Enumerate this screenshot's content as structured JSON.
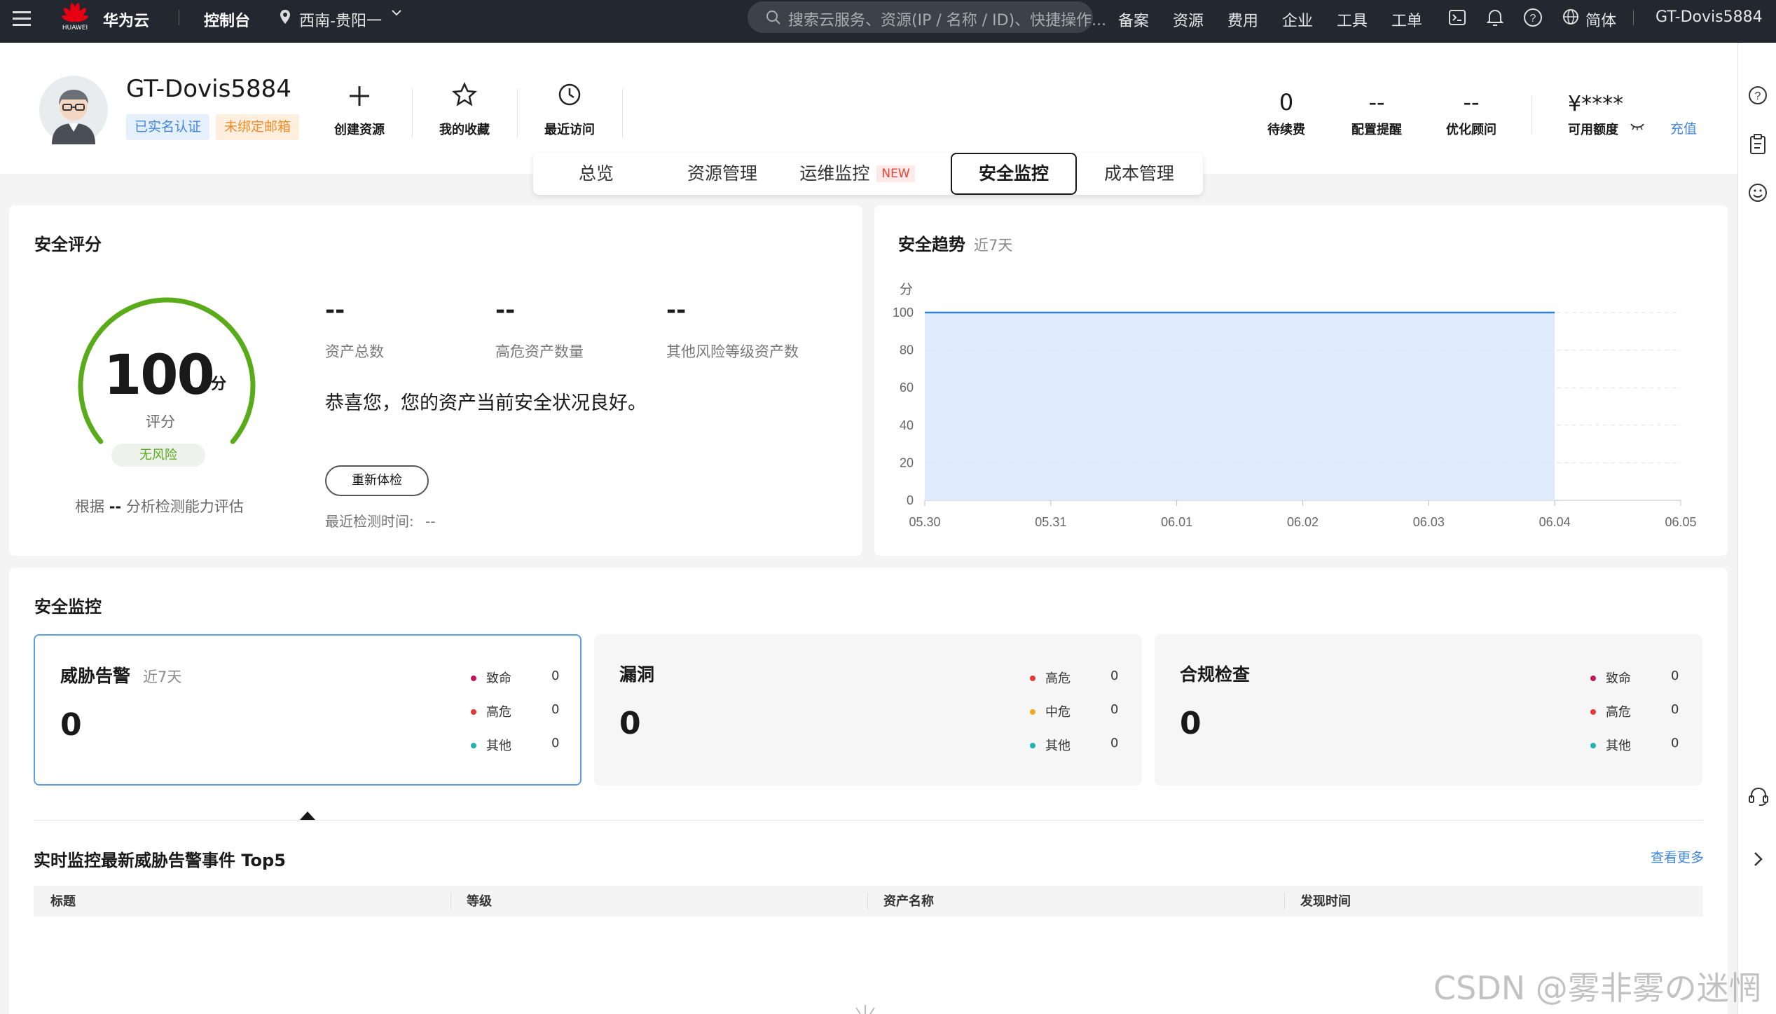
{
  "topbar": {
    "brand_logo_text": "HUAWEI",
    "brand": "华为云",
    "console": "控制台",
    "region": "西南-贵阳一",
    "search_placeholder": "搜索云服务、资源(IP / 名称 / ID)、快捷操作...",
    "nav": [
      "备案",
      "资源",
      "费用",
      "企业",
      "工具",
      "工单"
    ],
    "language": "简体",
    "user": "GT-Dovis5884"
  },
  "profile": {
    "username": "GT-Dovis5884",
    "badge_verified": "已实名认证",
    "badge_email": "未绑定邮箱",
    "quick_actions": [
      {
        "label": "创建资源",
        "icon": "plus-icon"
      },
      {
        "label": "我的收藏",
        "icon": "star-icon"
      },
      {
        "label": "最近访问",
        "icon": "clock-icon"
      }
    ],
    "stats": [
      {
        "value": "0",
        "label": "待续费"
      },
      {
        "value": "--",
        "label": "配置提醒"
      },
      {
        "value": "--",
        "label": "优化顾问"
      }
    ],
    "credit_value": "¥****",
    "credit_label": "可用额度",
    "recharge": "充值"
  },
  "tabs": [
    {
      "label": "总览"
    },
    {
      "label": "资源管理"
    },
    {
      "label": "运维监控",
      "tag": "NEW"
    },
    {
      "label": "安全监控",
      "active": true
    },
    {
      "label": "成本管理"
    }
  ],
  "score_card": {
    "title": "安全评分",
    "score": "100",
    "score_unit": "分",
    "score_label": "评分",
    "risk_badge": "无风险",
    "basis_prefix": "根据",
    "basis_value": "--",
    "basis_suffix": "分析检测能力评估",
    "score_fraction": 1.0,
    "metrics": [
      {
        "value": "--",
        "label": "资产总数"
      },
      {
        "value": "--",
        "label": "高危资产数量"
      },
      {
        "value": "--",
        "label": "其他风险等级资产数"
      }
    ],
    "message": "恭喜您，您的资产当前安全状况良好。",
    "recheck_button": "重新体检",
    "last_check_label": "最近检测时间:",
    "last_check_value": "--"
  },
  "trend_card": {
    "title": "安全趋势",
    "subtitle": "近7天"
  },
  "chart_data": {
    "type": "area",
    "title": "安全趋势",
    "ylabel": "分",
    "x": [
      "05.30",
      "05.31",
      "06.01",
      "06.02",
      "06.03",
      "06.04",
      "06.05"
    ],
    "values": [
      100,
      100,
      100,
      100,
      100,
      100,
      null
    ],
    "yticks": [
      0,
      20,
      40,
      60,
      80,
      100
    ],
    "ylim": [
      0,
      100
    ],
    "grid": true,
    "colors": {
      "line": "#2f7fe0",
      "fill": "#dbe9fb"
    }
  },
  "monitor": {
    "title": "安全监控",
    "boxes": [
      {
        "title": "威胁告警",
        "subtitle": "近7天",
        "value": "0",
        "selected": true,
        "legend": [
          {
            "label": "致命",
            "count": "0",
            "color": "#c2185b"
          },
          {
            "label": "高危",
            "count": "0",
            "color": "#e53935"
          },
          {
            "label": "其他",
            "count": "0",
            "color": "#1fb5ad"
          }
        ]
      },
      {
        "title": "漏洞",
        "subtitle": "",
        "value": "0",
        "selected": false,
        "legend": [
          {
            "label": "高危",
            "count": "0",
            "color": "#e53935"
          },
          {
            "label": "中危",
            "count": "0",
            "color": "#f5a623"
          },
          {
            "label": "其他",
            "count": "0",
            "color": "#1fb5ad"
          }
        ]
      },
      {
        "title": "合规检查",
        "subtitle": "",
        "value": "0",
        "selected": false,
        "legend": [
          {
            "label": "致命",
            "count": "0",
            "color": "#c2185b"
          },
          {
            "label": "高危",
            "count": "0",
            "color": "#e53935"
          },
          {
            "label": "其他",
            "count": "0",
            "color": "#1fb5ad"
          }
        ]
      }
    ],
    "top5_title": "实时监控最新威胁告警事件 Top5",
    "view_more": "查看更多",
    "columns": [
      "标题",
      "等级",
      "资产名称",
      "发现时间"
    ]
  },
  "watermark": "CSDN @雾非雾の迷惘"
}
